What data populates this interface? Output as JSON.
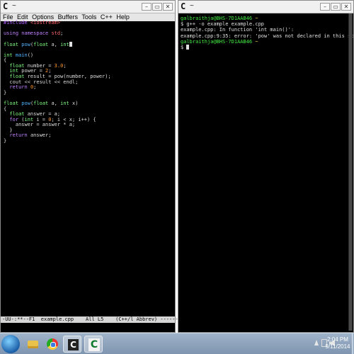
{
  "left_window": {
    "title": "~",
    "menu": [
      "File",
      "Edit",
      "Options",
      "Buffers",
      "Tools",
      "C++",
      "Help"
    ],
    "code": [
      [
        {
          "t": "#include ",
          "c": "c-pre"
        },
        {
          "t": "<iostream>",
          "c": "c-inc"
        }
      ],
      [],
      [
        {
          "t": "using namespace ",
          "c": "c-kw"
        },
        {
          "t": "std",
          "c": "c-inc"
        },
        {
          "t": ";",
          "c": "c-pl"
        }
      ],
      [],
      [
        {
          "t": "float ",
          "c": "c-ty"
        },
        {
          "t": "pow",
          "c": "c-fn"
        },
        {
          "t": "(",
          "c": "c-pl"
        },
        {
          "t": "float ",
          "c": "c-ty"
        },
        {
          "t": "a, ",
          "c": "c-pl"
        },
        {
          "t": "int",
          "c": "c-ty"
        }
      ],
      [],
      [
        {
          "t": "int ",
          "c": "c-ty"
        },
        {
          "t": "main",
          "c": "c-fn"
        },
        {
          "t": "()",
          "c": "c-pl"
        }
      ],
      [
        {
          "t": "{",
          "c": "c-pl"
        }
      ],
      [
        {
          "t": "  float ",
          "c": "c-ty"
        },
        {
          "t": "number = ",
          "c": "c-pl"
        },
        {
          "t": "3.0",
          "c": "c-num"
        },
        {
          "t": ";",
          "c": "c-pl"
        }
      ],
      [
        {
          "t": "  int ",
          "c": "c-ty"
        },
        {
          "t": "power = ",
          "c": "c-pl"
        },
        {
          "t": "2",
          "c": "c-num"
        },
        {
          "t": ";",
          "c": "c-pl"
        }
      ],
      [
        {
          "t": "  float ",
          "c": "c-ty"
        },
        {
          "t": "result = pow(number, power);",
          "c": "c-pl"
        }
      ],
      [
        {
          "t": "  cout << result << endl;",
          "c": "c-pl"
        }
      ],
      [
        {
          "t": "  return ",
          "c": "c-kw"
        },
        {
          "t": "0",
          "c": "c-num"
        },
        {
          "t": ";",
          "c": "c-pl"
        }
      ],
      [
        {
          "t": "}",
          "c": "c-pl"
        }
      ],
      [],
      [
        {
          "t": "float ",
          "c": "c-ty"
        },
        {
          "t": "pow",
          "c": "c-fn"
        },
        {
          "t": "(",
          "c": "c-pl"
        },
        {
          "t": "float ",
          "c": "c-ty"
        },
        {
          "t": "a, ",
          "c": "c-pl"
        },
        {
          "t": "int ",
          "c": "c-ty"
        },
        {
          "t": "x)",
          "c": "c-pl"
        }
      ],
      [
        {
          "t": "{",
          "c": "c-pl"
        }
      ],
      [
        {
          "t": "  float ",
          "c": "c-ty"
        },
        {
          "t": "answer = a;",
          "c": "c-pl"
        }
      ],
      [
        {
          "t": "  for ",
          "c": "c-kw"
        },
        {
          "t": "(",
          "c": "c-pl"
        },
        {
          "t": "int ",
          "c": "c-ty"
        },
        {
          "t": "i = ",
          "c": "c-pl"
        },
        {
          "t": "0",
          "c": "c-num"
        },
        {
          "t": "; i < x; i++) {",
          "c": "c-pl"
        }
      ],
      [
        {
          "t": "    answer = answer * a;",
          "c": "c-pl"
        }
      ],
      [
        {
          "t": "  }",
          "c": "c-pl"
        }
      ],
      [
        {
          "t": "  return ",
          "c": "c-kw"
        },
        {
          "t": "answer;",
          "c": "c-pl"
        }
      ],
      [
        {
          "t": "}",
          "c": "c-pl"
        }
      ]
    ],
    "modeline": "-UU-:**--F1  example.cpp    All L5    (C++/l Abbrev) -------------"
  },
  "right_window": {
    "title": "~",
    "lines": [
      [
        {
          "t": "galbraithja@BHS-7D1AAB46 ",
          "c": "t-user"
        },
        {
          "t": "~",
          "c": "t-path"
        }
      ],
      [
        {
          "t": "$ g++ -o example example.cpp",
          "c": "t-pl"
        }
      ],
      [
        {
          "t": "example.cpp: In function 'int main()':",
          "c": "t-pl"
        }
      ],
      [
        {
          "t": "example.cpp:9:35: error: 'pow' was not declared in this scope",
          "c": "t-pl"
        }
      ],
      [],
      [
        {
          "t": "galbraithja@BHS-7D1AAB46 ",
          "c": "t-user"
        },
        {
          "t": "~",
          "c": "t-path"
        }
      ],
      [
        {
          "t": "$ ",
          "c": "t-pl"
        }
      ]
    ]
  },
  "taskbar": {
    "items": [
      "folder-icon",
      "chrome-icon",
      "cygwin-icon",
      "cygwin-icon"
    ],
    "time": "2:04 PM",
    "date": "9/11/2014"
  }
}
